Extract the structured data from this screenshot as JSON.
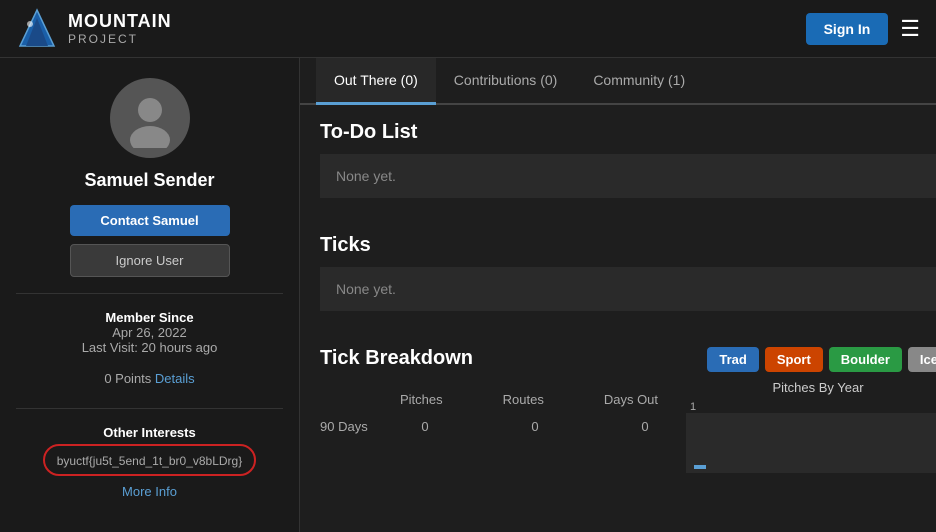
{
  "header": {
    "logo_mountain": "MOUNTAIN",
    "logo_project": "PROJECT",
    "sign_in_label": "Sign In"
  },
  "sidebar": {
    "user_name": "Samuel Sender",
    "contact_btn": "Contact Samuel",
    "ignore_btn": "Ignore User",
    "member_since_label": "Member Since",
    "member_since_date": "Apr 26, 2022",
    "last_visit": "Last Visit: 20 hours ago",
    "points": "0 Points",
    "details_link": "Details",
    "other_interests_label": "Other Interests",
    "interests_text": "byuctf{ju5t_5end_1t_br0_v8bLDrg}",
    "more_info_link": "More Info"
  },
  "tabs": [
    {
      "label": "Out There",
      "count": "(0)",
      "active": true
    },
    {
      "label": "Contributions",
      "count": "(0)",
      "active": false
    },
    {
      "label": "Community",
      "count": "(1)",
      "active": false
    }
  ],
  "todo": {
    "title": "To-Do List",
    "empty_text": "None yet."
  },
  "ticks": {
    "title": "Ticks",
    "empty_text": "None yet."
  },
  "tick_breakdown": {
    "title": "Tick Breakdown",
    "type_btns": [
      {
        "label": "Trad",
        "type": "trad"
      },
      {
        "label": "Sport",
        "type": "sport"
      },
      {
        "label": "Boulder",
        "type": "boulder"
      },
      {
        "label": "Ice",
        "type": "ice"
      }
    ],
    "columns": [
      "Pitches",
      "Routes",
      "Days Out"
    ],
    "rows": [
      {
        "label": "90 Days",
        "values": [
          "0",
          "0",
          "0"
        ]
      }
    ]
  },
  "pitches_by_year": {
    "title": "Pitches By Year",
    "year_value": "1"
  }
}
